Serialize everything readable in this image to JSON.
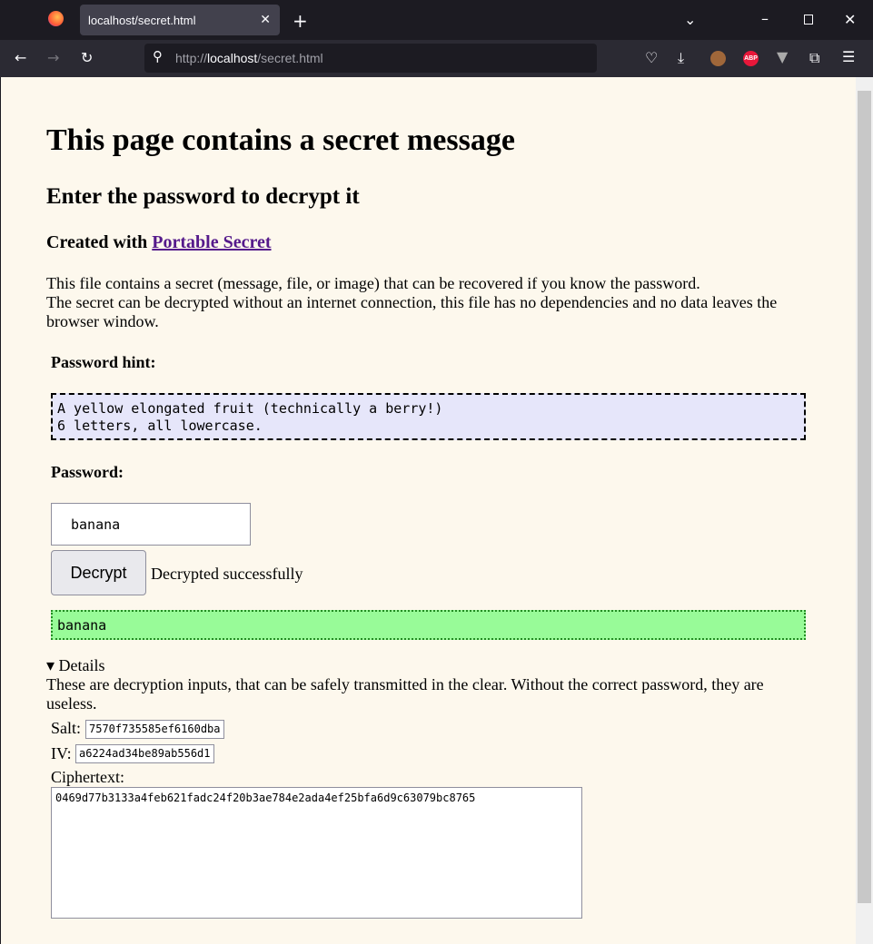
{
  "browser": {
    "tab_title": "localhost/secret.html",
    "url_prefix": "http://",
    "url_host": "localhost",
    "url_path": "/secret.html"
  },
  "page": {
    "title": "This page contains a secret message",
    "subtitle": "Enter the password to decrypt it",
    "created_with": "Created with",
    "link": "Portable Secret",
    "intro1": "This file contains a secret (message, file, or image) that can be recovered if you know the password.",
    "intro2": "The secret can be decrypted without an internet connection, this file has no dependencies and no data leaves the browser window.",
    "hint_label": "Password hint:",
    "hint": "A yellow elongated fruit (technically a berry!)\n6 letters, all lowercase.",
    "password_label": "Password:",
    "password_value": "banana",
    "decrypt_label": "Decrypt",
    "status": "Decrypted successfully",
    "output": "banana",
    "details_summary": "▾ Details",
    "details_text": "These are decryption inputs, that can be safely transmitted in the clear. Without the correct password, they are useless.",
    "salt_label": "Salt:",
    "salt": "7570f735585ef6160dba",
    "iv_label": "IV:",
    "iv": "a6224ad34be89ab556d1",
    "ciphertext_label": "Ciphertext:",
    "ciphertext": "0469d77b3133a4feb621fadc24f20b3ae784e2ada4ef25bfa6d9c63079bc8765"
  }
}
